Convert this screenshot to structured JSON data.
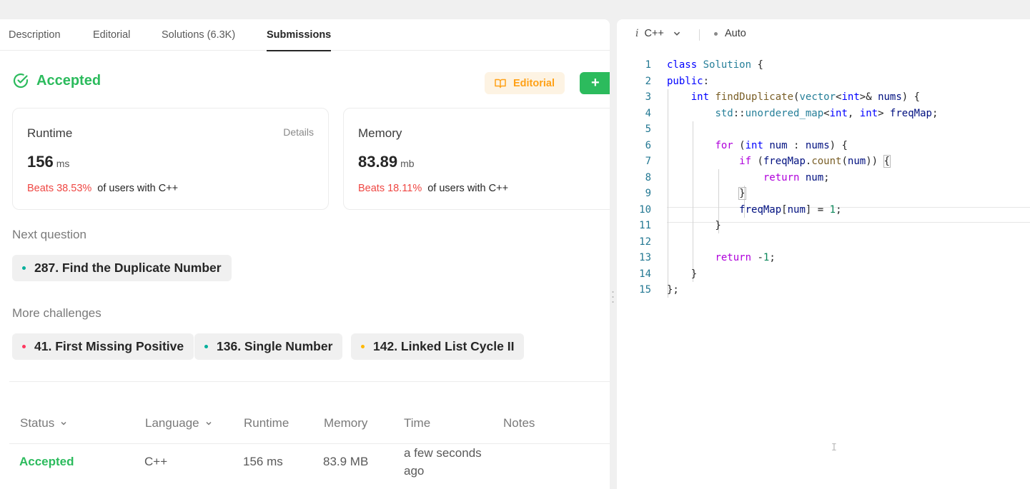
{
  "tabs": [
    "Description",
    "Editorial",
    "Solutions (6.3K)",
    "Submissions"
  ],
  "result": {
    "status": "Accepted",
    "editorial_button": "Editorial",
    "add_button": "+"
  },
  "runtime_card": {
    "title": "Runtime",
    "details": "Details",
    "value": "156",
    "unit": "ms",
    "beats": "Beats 38.53%",
    "of_users": "of users with C++"
  },
  "memory_card": {
    "title": "Memory",
    "value": "83.89",
    "unit": "mb",
    "beats": "Beats 18.11%",
    "of_users": "of users with C++"
  },
  "next_question": {
    "label": "Next question",
    "item": "287. Find the Duplicate Number",
    "dot_color": "#00af9b"
  },
  "more_challenges": {
    "label": "More challenges",
    "items": [
      {
        "text": "41. First Missing Positive",
        "dot_color": "#ff375f"
      },
      {
        "text": "136. Single Number",
        "dot_color": "#00af9b"
      },
      {
        "text": "142. Linked List Cycle II",
        "dot_color": "#ffb800"
      }
    ]
  },
  "table": {
    "headers": [
      "Status",
      "Language",
      "Runtime",
      "Memory",
      "Time",
      "Notes"
    ],
    "row": {
      "status": "Accepted",
      "language": "C++",
      "runtime": "156 ms",
      "memory": "83.9 MB",
      "time_line1": "a few seconds",
      "time_line2": "ago"
    }
  },
  "editor": {
    "language": "C++",
    "mode": "Auto",
    "line_numbers": [
      "1",
      "2",
      "3",
      "4",
      "5",
      "6",
      "7",
      "8",
      "9",
      "10",
      "11",
      "12",
      "13",
      "14",
      "15"
    ]
  },
  "colors": {
    "accepted": "#2cbb5d",
    "beats": "#ef4743",
    "editorial": "#ffa116"
  }
}
